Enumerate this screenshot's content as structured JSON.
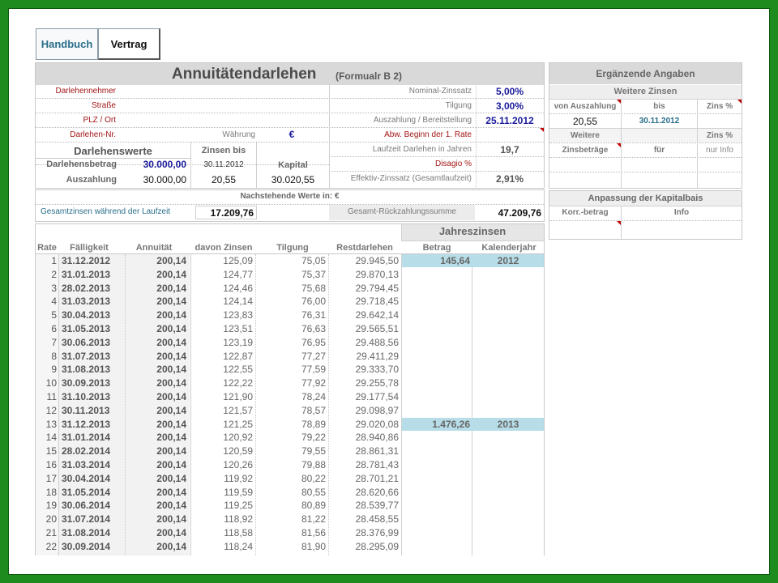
{
  "tabs": {
    "handbuch": "Handbuch",
    "vertrag": "Vertrag"
  },
  "main": {
    "title": "Annuitätendarlehen",
    "subtitle": "(Formualr B 2)",
    "left_labels": {
      "darlehennehmer": "Darlehennehmer",
      "strasse": "Straße",
      "plz_ort": "PLZ / Ort",
      "darlehen_nr": "Darlehen-Nr.",
      "waehrung_label": "Währung",
      "waehrung_value": "€"
    },
    "right_rows": {
      "nominal_label": "Nominal-Zinssatz",
      "nominal_value": "5,00%",
      "tilgung_label": "Tilgung",
      "tilgung_value": "3,00%",
      "auszahlung_label": "Auszahlung / Bereitstellung",
      "auszahlung_value": "25.11.2012",
      "abw_label": "Abw. Beginn der 1. Rate",
      "laufzeit_label": "Laufzeit Darlehen in Jahren",
      "laufzeit_value": "19,7",
      "disagio_label": "Disagio %",
      "effektiv_label": "Effektiv-Zinssatz (Gesamtlaufzeit)",
      "effektiv_value": "2,91%"
    },
    "darlehenswerte": {
      "header": "Darlehenswerte",
      "zinsen_bis": "Zinsen bis",
      "zinsen_bis_date": "30.11.2012",
      "kapital": "Kapital",
      "betrag_label": "Darlehensbetrag",
      "betrag_value": "30.000,00",
      "auszahlung_label": "Auszahlung",
      "auszahlung_value": "30.000,00",
      "zinsen_value": "20,55",
      "kapital_value": "30.020,55"
    }
  },
  "summary": {
    "header": "Nachstehende Werte in:  €",
    "gesamtzinsen_label": "Gesamtzinsen während der Laufzeit",
    "gesamtzinsen_value": "17.209,76",
    "rueckzahlung_label": "Gesamt-Rückzahlungssumme",
    "rueckzahlung_value": "47.209,76"
  },
  "side": {
    "title": "Ergänzende Angaben",
    "weitere_zinsen": "Weitere Zinsen",
    "von_auszahlung": "von Auszahlung",
    "bis": "bis",
    "zins_pct": "Zins %",
    "von_value": "20,55",
    "bis_value": "30.11.2012",
    "weitere": "Weitere",
    "zins_pct2": "Zins %",
    "zinsbetraege": "Zinsbeträge",
    "fuer": "für",
    "nur_info": "nur Info",
    "anpassung_title": "Anpassung der Kapitalbais",
    "korr_betrag": "Korr.-betrag",
    "info": "Info"
  },
  "schedule": {
    "jahreszinsen": "Jahreszinsen",
    "columns": {
      "rate": "Rate",
      "faelligkeit": "Fälligkeit",
      "annuitaet": "Annuität",
      "zinsen": "davon Zinsen",
      "tilgung": "Tilgung",
      "rest": "Restdarlehen",
      "betrag": "Betrag",
      "jahr": "Kalenderjahr"
    },
    "rows": [
      {
        "rate": "1",
        "date": "31.12.2012",
        "annuitaet": "200,14",
        "zinsen": "125,09",
        "tilgung": "75,05",
        "rest": "29.945,50",
        "betrag": "145,64",
        "jahr": "2012"
      },
      {
        "rate": "2",
        "date": "31.01.2013",
        "annuitaet": "200,14",
        "zinsen": "124,77",
        "tilgung": "75,37",
        "rest": "29.870,13",
        "betrag": "",
        "jahr": ""
      },
      {
        "rate": "3",
        "date": "28.02.2013",
        "annuitaet": "200,14",
        "zinsen": "124,46",
        "tilgung": "75,68",
        "rest": "29.794,45",
        "betrag": "",
        "jahr": ""
      },
      {
        "rate": "4",
        "date": "31.03.2013",
        "annuitaet": "200,14",
        "zinsen": "124,14",
        "tilgung": "76,00",
        "rest": "29.718,45",
        "betrag": "",
        "jahr": ""
      },
      {
        "rate": "5",
        "date": "30.04.2013",
        "annuitaet": "200,14",
        "zinsen": "123,83",
        "tilgung": "76,31",
        "rest": "29.642,14",
        "betrag": "",
        "jahr": ""
      },
      {
        "rate": "6",
        "date": "31.05.2013",
        "annuitaet": "200,14",
        "zinsen": "123,51",
        "tilgung": "76,63",
        "rest": "29.565,51",
        "betrag": "",
        "jahr": ""
      },
      {
        "rate": "7",
        "date": "30.06.2013",
        "annuitaet": "200,14",
        "zinsen": "123,19",
        "tilgung": "76,95",
        "rest": "29.488,56",
        "betrag": "",
        "jahr": ""
      },
      {
        "rate": "8",
        "date": "31.07.2013",
        "annuitaet": "200,14",
        "zinsen": "122,87",
        "tilgung": "77,27",
        "rest": "29.411,29",
        "betrag": "",
        "jahr": ""
      },
      {
        "rate": "9",
        "date": "31.08.2013",
        "annuitaet": "200,14",
        "zinsen": "122,55",
        "tilgung": "77,59",
        "rest": "29.333,70",
        "betrag": "",
        "jahr": ""
      },
      {
        "rate": "10",
        "date": "30.09.2013",
        "annuitaet": "200,14",
        "zinsen": "122,22",
        "tilgung": "77,92",
        "rest": "29.255,78",
        "betrag": "",
        "jahr": ""
      },
      {
        "rate": "11",
        "date": "31.10.2013",
        "annuitaet": "200,14",
        "zinsen": "121,90",
        "tilgung": "78,24",
        "rest": "29.177,54",
        "betrag": "",
        "jahr": ""
      },
      {
        "rate": "12",
        "date": "30.11.2013",
        "annuitaet": "200,14",
        "zinsen": "121,57",
        "tilgung": "78,57",
        "rest": "29.098,97",
        "betrag": "",
        "jahr": ""
      },
      {
        "rate": "13",
        "date": "31.12.2013",
        "annuitaet": "200,14",
        "zinsen": "121,25",
        "tilgung": "78,89",
        "rest": "29.020,08",
        "betrag": "1.476,26",
        "jahr": "2013"
      },
      {
        "rate": "14",
        "date": "31.01.2014",
        "annuitaet": "200,14",
        "zinsen": "120,92",
        "tilgung": "79,22",
        "rest": "28.940,86",
        "betrag": "",
        "jahr": ""
      },
      {
        "rate": "15",
        "date": "28.02.2014",
        "annuitaet": "200,14",
        "zinsen": "120,59",
        "tilgung": "79,55",
        "rest": "28.861,31",
        "betrag": "",
        "jahr": ""
      },
      {
        "rate": "16",
        "date": "31.03.2014",
        "annuitaet": "200,14",
        "zinsen": "120,26",
        "tilgung": "79,88",
        "rest": "28.781,43",
        "betrag": "",
        "jahr": ""
      },
      {
        "rate": "17",
        "date": "30.04.2014",
        "annuitaet": "200,14",
        "zinsen": "119,92",
        "tilgung": "80,22",
        "rest": "28.701,21",
        "betrag": "",
        "jahr": ""
      },
      {
        "rate": "18",
        "date": "31.05.2014",
        "annuitaet": "200,14",
        "zinsen": "119,59",
        "tilgung": "80,55",
        "rest": "28.620,66",
        "betrag": "",
        "jahr": ""
      },
      {
        "rate": "19",
        "date": "30.06.2014",
        "annuitaet": "200,14",
        "zinsen": "119,25",
        "tilgung": "80,89",
        "rest": "28.539,77",
        "betrag": "",
        "jahr": ""
      },
      {
        "rate": "20",
        "date": "31.07.2014",
        "annuitaet": "200,14",
        "zinsen": "118,92",
        "tilgung": "81,22",
        "rest": "28.458,55",
        "betrag": "",
        "jahr": ""
      },
      {
        "rate": "21",
        "date": "31.08.2014",
        "annuitaet": "200,14",
        "zinsen": "118,58",
        "tilgung": "81,56",
        "rest": "28.376,99",
        "betrag": "",
        "jahr": ""
      },
      {
        "rate": "22",
        "date": "30.09.2014",
        "annuitaet": "200,14",
        "zinsen": "118,24",
        "tilgung": "81,90",
        "rest": "28.295,09",
        "betrag": "",
        "jahr": ""
      }
    ]
  }
}
